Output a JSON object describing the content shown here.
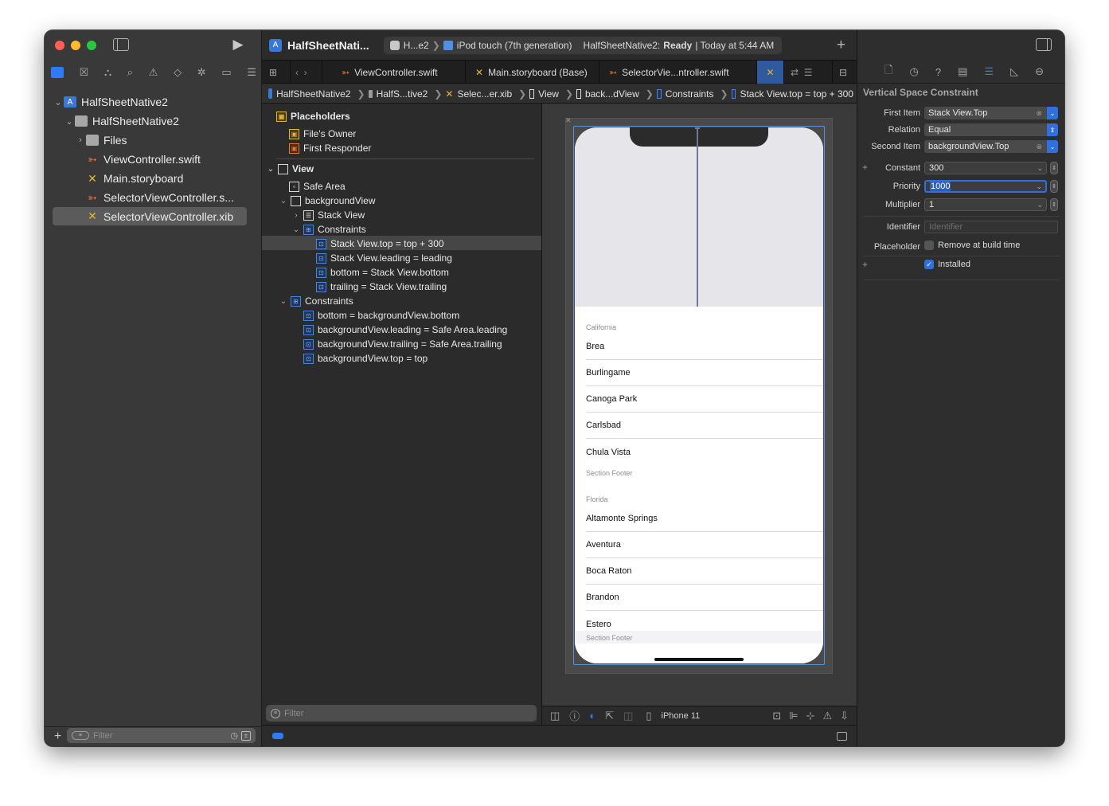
{
  "toolbar": {
    "project_title": "HalfSheetNati...",
    "scheme": "H...e2",
    "device": "iPod touch (7th generation)",
    "status_app": "HalfSheetNative2:",
    "status_state": "Ready",
    "status_time": "| Today at 5:44 AM"
  },
  "navigator": {
    "items": [
      {
        "label": "HalfSheetNative2",
        "icon": "project-icon"
      },
      {
        "label": "HalfSheetNative2",
        "icon": "folder-icon"
      },
      {
        "label": "Files",
        "icon": "folder-icon"
      },
      {
        "label": "ViewController.swift",
        "icon": "swift-file-icon"
      },
      {
        "label": "Main.storyboard",
        "icon": "storyboard-icon"
      },
      {
        "label": "SelectorViewController.s...",
        "icon": "swift-file-icon"
      },
      {
        "label": "SelectorViewController.xib",
        "icon": "xib-icon"
      }
    ],
    "filter_placeholder": "Filter"
  },
  "tabs": [
    {
      "label": "ViewController.swift"
    },
    {
      "label": "Main.storyboard (Base)"
    },
    {
      "label": "SelectorVie...ntroller.swift"
    }
  ],
  "breadcrumb": [
    "HalfSheetNative2",
    "HalfS...tive2",
    "Selec...er.xib",
    "View",
    "back...dView",
    "Constraints",
    "Stack View.top = top + 300"
  ],
  "outline": {
    "placeholders_header": "Placeholders",
    "files_owner": "File's Owner",
    "first_responder": "First Responder",
    "view": "View",
    "safe_area": "Safe Area",
    "background_view": "backgroundView",
    "stack_view": "Stack View",
    "constraints_inner": "Constraints",
    "inner_constraints": [
      "Stack View.top = top + 300",
      "Stack View.leading = leading",
      "bottom = Stack View.bottom",
      "trailing = Stack View.trailing"
    ],
    "constraints_outer": "Constraints",
    "outer_constraints": [
      "bottom = backgroundView.bottom",
      "backgroundView.leading = Safe Area.leading",
      "backgroundView.trailing = Safe Area.trailing",
      "backgroundView.top = top"
    ],
    "filter_placeholder": "Filter"
  },
  "phone": {
    "sections": [
      {
        "header": "California",
        "rows": [
          "Brea",
          "Burlingame",
          "Canoga Park",
          "Carlsbad",
          "Chula Vista"
        ],
        "footer": "Section Footer"
      },
      {
        "header": "Florida",
        "rows": [
          "Altamonte Springs",
          "Aventura",
          "Boca Raton",
          "Brandon",
          "Estero"
        ],
        "footer": "Section Footer"
      }
    ]
  },
  "canvas_bar": {
    "device_label": "iPhone 11"
  },
  "inspector": {
    "title": "Vertical Space Constraint",
    "first_item_label": "First Item",
    "first_item_value": "Stack View.Top",
    "relation_label": "Relation",
    "relation_value": "Equal",
    "second_item_label": "Second Item",
    "second_item_value": "backgroundView.Top",
    "constant_label": "Constant",
    "constant_value": "300",
    "priority_label": "Priority",
    "priority_value": "1000",
    "multiplier_label": "Multiplier",
    "multiplier_value": "1",
    "identifier_label": "Identifier",
    "identifier_placeholder": "Identifier",
    "placeholder_label": "Placeholder",
    "remove_at_build_time": "Remove at build time",
    "installed": "Installed"
  },
  "colors": {
    "accent": "#2f6fe0",
    "window_bg": "#2b2b2b",
    "sidebar_bg": "#3a3939"
  }
}
